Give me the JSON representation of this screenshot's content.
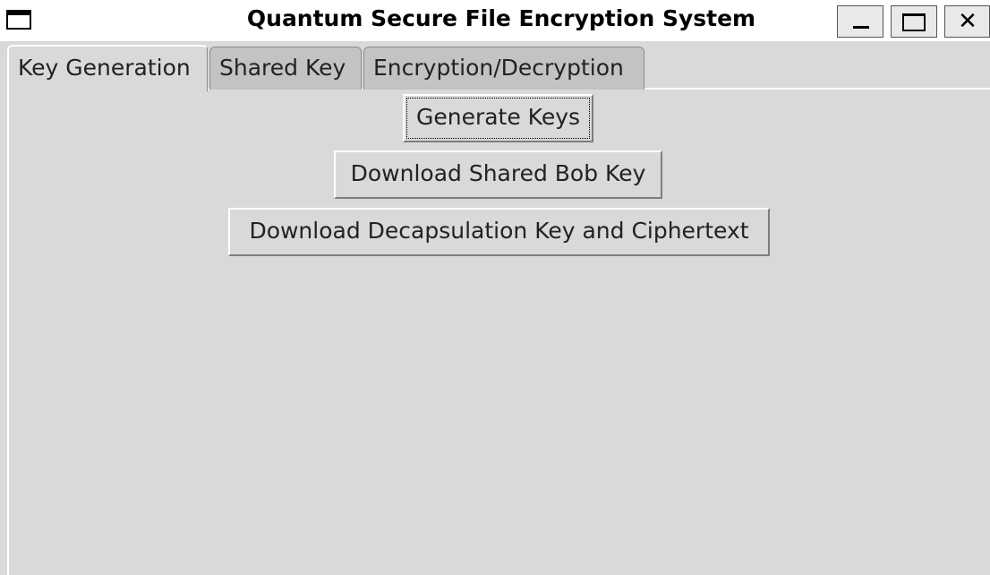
{
  "window": {
    "title": "Quantum Secure File Encryption System",
    "controls": {
      "minimize_icon": "minimize-icon",
      "maximize_icon": "maximize-icon",
      "close_icon": "close-icon",
      "close_glyph": "✕"
    }
  },
  "tabs": [
    {
      "label": "Key Generation",
      "selected": true
    },
    {
      "label": "Shared Key",
      "selected": false
    },
    {
      "label": "Encryption/Decryption",
      "selected": false
    }
  ],
  "key_generation": {
    "generate_keys_label": "Generate Keys",
    "download_shared_bob_key_label": "Download Shared Bob Key",
    "download_decapsulation_label": "Download Decapsulation Key and Ciphertext"
  },
  "colors": {
    "background": "#d9d9d9",
    "titlebar": "#ffffff",
    "tab_inactive": "#c3c3c3"
  }
}
